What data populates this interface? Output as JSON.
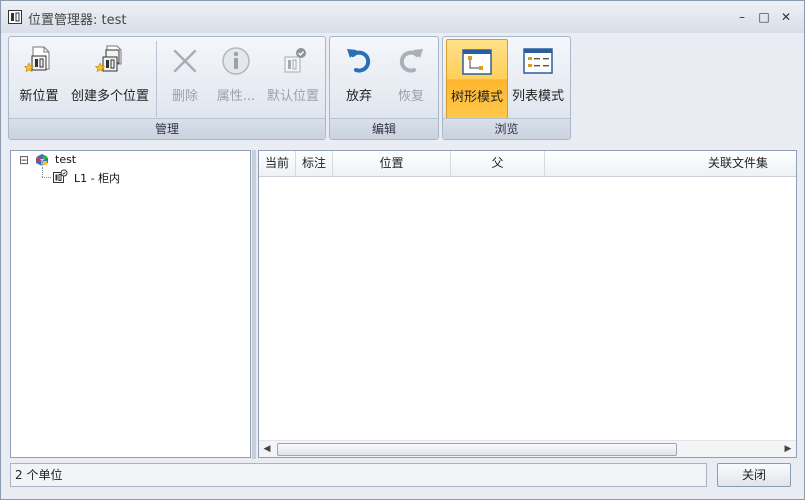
{
  "window": {
    "title": "位置管理器: test",
    "controls": {
      "minimize": "–",
      "maximize": "□",
      "close": "✕"
    }
  },
  "ribbon": {
    "groups": [
      {
        "caption": "管理",
        "buttons": [
          {
            "label": "新位置",
            "icon": "new-location-icon",
            "enabled": true
          },
          {
            "label": "创建多个位置",
            "icon": "create-multiple-locations-icon",
            "enabled": true
          },
          {
            "label": "删除",
            "icon": "delete-icon",
            "enabled": false
          },
          {
            "label": "属性...",
            "icon": "properties-icon",
            "enabled": false
          },
          {
            "label": "默认位置",
            "icon": "default-location-icon",
            "enabled": false
          }
        ]
      },
      {
        "caption": "编辑",
        "buttons": [
          {
            "label": "放弃",
            "icon": "undo-icon",
            "enabled": true
          },
          {
            "label": "恢复",
            "icon": "redo-icon",
            "enabled": false
          }
        ]
      },
      {
        "caption": "浏览",
        "buttons": [
          {
            "label": "树形模式",
            "icon": "tree-mode-icon",
            "enabled": true,
            "active": true
          },
          {
            "label": "列表模式",
            "icon": "list-mode-icon",
            "enabled": true
          }
        ]
      }
    ]
  },
  "tree": {
    "root": {
      "label": "test",
      "expanded": true,
      "expander": "⊟"
    },
    "children": [
      {
        "label": "L1 - 柜内"
      }
    ]
  },
  "list": {
    "columns": [
      "当前",
      "标注",
      "位置",
      "父",
      "关联文件集"
    ],
    "rows": []
  },
  "status": {
    "text": "2 个单位"
  },
  "close_button": {
    "label": "关闭"
  },
  "colors": {
    "active_button": "#ffc84a",
    "accent_blue": "#2a6fb5",
    "icon_orange": "#e49a1a"
  }
}
